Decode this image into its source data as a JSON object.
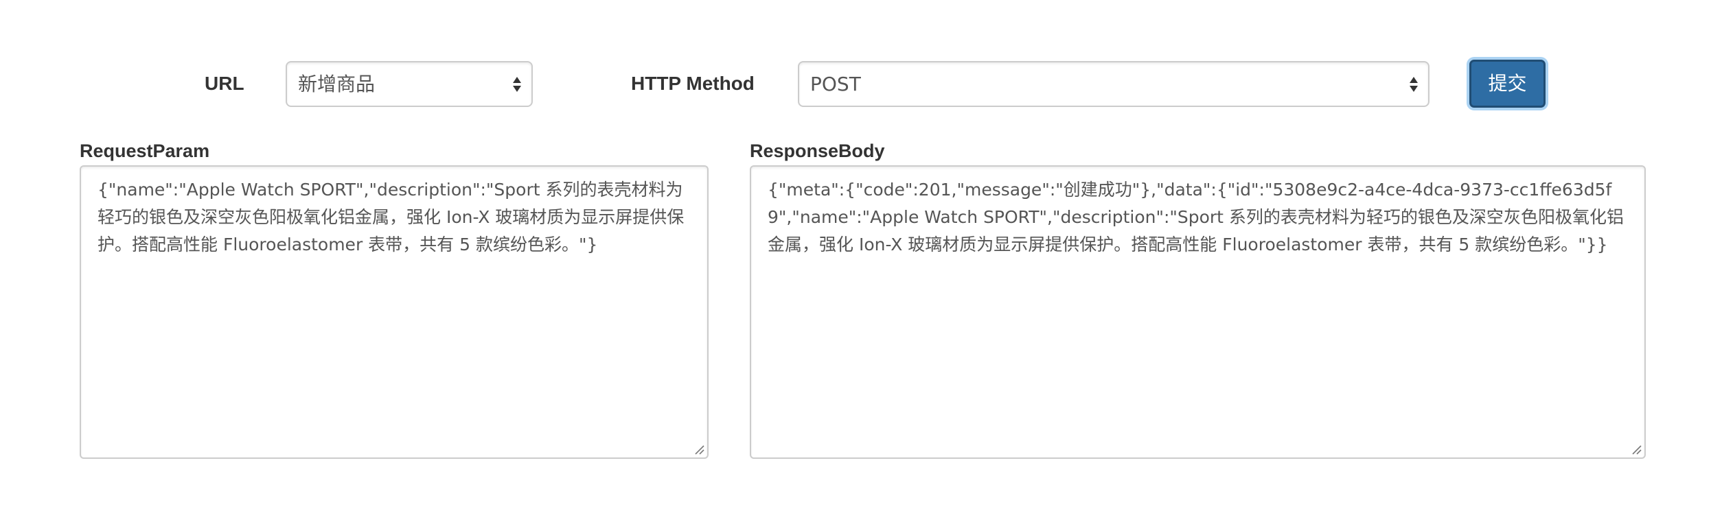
{
  "form": {
    "url_label": "URL",
    "url_selected": "新增商品",
    "method_label": "HTTP Method",
    "method_selected": "POST",
    "submit_label": "提交"
  },
  "request": {
    "label": "RequestParam",
    "body": "{\"name\":\"Apple Watch SPORT\",\"description\":\"Sport 系列的表壳材料为轻巧的银色及深空灰色阳极氧化铝金属，强化 Ion-X 玻璃材质为显示屏提供保护。搭配高性能 Fluoroelastomer 表带，共有 5 款缤纷色彩。\"}"
  },
  "response": {
    "label": "ResponseBody",
    "body": "{\"meta\":{\"code\":201,\"message\":\"创建成功\"},\"data\":{\"id\":\"5308e9c2-a4ce-4dca-9373-cc1ffe63d5f9\",\"name\":\"Apple Watch SPORT\",\"description\":\"Sport 系列的表壳材料为轻巧的银色及深空灰色阳极氧化铝金属，强化 Ion-X 玻璃材质为显示屏提供保护。搭配高性能 Fluoroelastomer 表带，共有 5 款缤纷色彩。\"}}"
  },
  "icons": {
    "select_arrows": "updown-arrows-icon",
    "resize": "resize-grip-icon"
  },
  "colors": {
    "primary_button": "#2e6da4",
    "border": "#cccccc",
    "text": "#333333"
  }
}
